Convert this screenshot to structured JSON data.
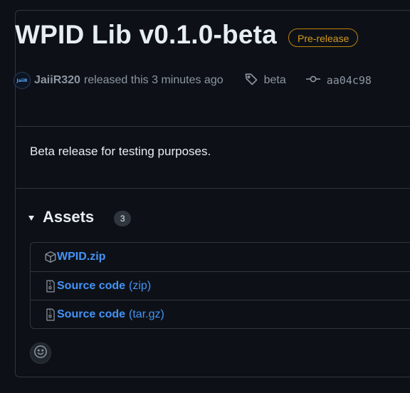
{
  "release": {
    "title": "WPID Lib v0.1.0-beta",
    "badge": "Pre-release",
    "author": "JaiiR320",
    "avatar_text": "JaiiR",
    "released_text": "released this 3 minutes ago",
    "tag": "beta",
    "commit": "aa04c98",
    "body": "Beta release for testing purposes."
  },
  "assets": {
    "title": "Assets",
    "count": "3",
    "items": [
      {
        "name": "WPID.zip",
        "ext": "",
        "icon": "package-icon"
      },
      {
        "name": "Source code",
        "ext": "(zip)",
        "icon": "file-zip-icon"
      },
      {
        "name": "Source code",
        "ext": "(tar.gz)",
        "icon": "file-zip-icon"
      }
    ]
  },
  "colors": {
    "background": "#0d1117",
    "border": "#30363d",
    "link": "#4493f8",
    "prerelease": "#d29922",
    "text": "#e6edf3",
    "muted": "#8d96a0"
  },
  "icons": {
    "tag": "tag-icon",
    "commit": "git-commit-icon",
    "reaction": "smiley-icon"
  }
}
